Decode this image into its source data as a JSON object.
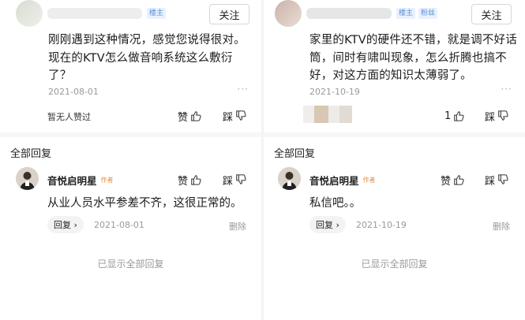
{
  "left": {
    "tags": [
      "楼主"
    ],
    "follow": "关注",
    "comment": "刚刚遇到这种情况，感觉您说得很对。现在的KTV怎么做音响系统这么敷衍了？",
    "date": "2021-08-01",
    "more": "···",
    "likers": "暂无人赞过",
    "like_label": "赞",
    "dislike_label": "踩",
    "all_replies": "全部回复",
    "reply": {
      "name": "音悦启明星",
      "author_tag": "作者",
      "text": "从业人员水平参差不齐，这很正常的。",
      "reply_btn": "回复 ›",
      "date": "2021-08-01",
      "delete": "删除"
    },
    "all_shown": "已显示全部回复"
  },
  "right": {
    "tags": [
      "楼主",
      "粉丝"
    ],
    "follow": "关注",
    "comment": "家里的KTV的硬件还不错，就是调不好话筒，间时有啸叫现象，怎么折腾也搞不好，对这方面的知识太薄弱了。",
    "date": "2021-10-19",
    "more": "···",
    "like_count": "1",
    "dislike_label": "踩",
    "all_replies": "全部回复",
    "reply": {
      "name": "音悦启明星",
      "author_tag": "作者",
      "text": "私信吧。。",
      "reply_btn": "回复 ›",
      "date": "2021-10-19",
      "delete": "删除"
    },
    "all_shown": "已显示全部回复"
  }
}
